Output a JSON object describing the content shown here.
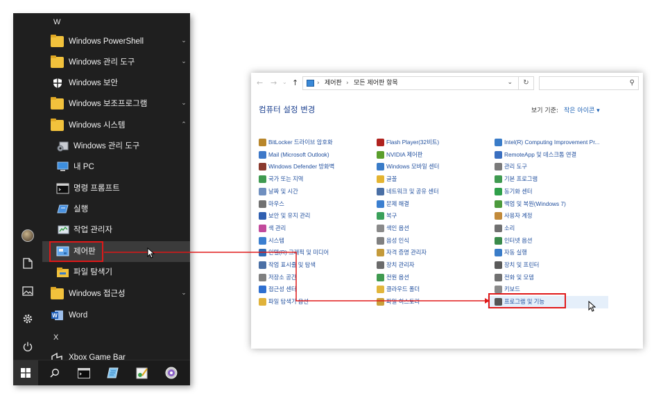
{
  "start_menu": {
    "letters": {
      "w": "W",
      "x": "X"
    },
    "apps": [
      {
        "name": "windows-powershell",
        "label": "Windows PowerShell",
        "icon": "folder-icon",
        "chevron": "down"
      },
      {
        "name": "windows-admin-tools",
        "label": "Windows 관리 도구",
        "icon": "folder-icon",
        "chevron": "down"
      },
      {
        "name": "windows-security",
        "label": "Windows 보안",
        "icon": "shield-icon"
      },
      {
        "name": "windows-accessories",
        "label": "Windows 보조프로그램",
        "icon": "folder-icon",
        "chevron": "down"
      },
      {
        "name": "windows-system",
        "label": "Windows 시스템",
        "icon": "folder-icon",
        "chevron": "up"
      },
      {
        "name": "admin-tools",
        "label": "Windows 관리 도구",
        "icon": "admin-tools-icon"
      },
      {
        "name": "my-pc",
        "label": "내 PC",
        "icon": "computer-icon"
      },
      {
        "name": "command-prompt",
        "label": "명령 프롬프트",
        "icon": "terminal-icon"
      },
      {
        "name": "run",
        "label": "실행",
        "icon": "run-icon"
      },
      {
        "name": "task-manager",
        "label": "작업 관리자",
        "icon": "task-manager-icon"
      },
      {
        "name": "control-panel",
        "label": "제어판",
        "icon": "control-panel-icon"
      },
      {
        "name": "file-explorer",
        "label": "파일 탐색기",
        "icon": "file-explorer-icon"
      },
      {
        "name": "windows-accessibility",
        "label": "Windows 접근성",
        "icon": "folder-icon",
        "chevron": "down"
      },
      {
        "name": "word",
        "label": "Word",
        "icon": "word-icon"
      },
      {
        "name": "xbox-game-bar",
        "label": "Xbox Game Bar",
        "icon": "xbox-icon"
      }
    ],
    "rail_icons": [
      "avatar-icon",
      "document-icon",
      "pictures-icon",
      "settings-icon",
      "power-icon"
    ],
    "taskbar_icons": [
      "windows-start-icon",
      "search-icon",
      "terminal-icon",
      "notepad-icon",
      "paint-icon",
      "media-player-icon"
    ]
  },
  "control_panel": {
    "address": {
      "root": "제어판",
      "current": "모든 제어판 항목",
      "separator": "›"
    },
    "title": "컴퓨터 설정 변경",
    "view_by_label": "보기 기준:",
    "view_mode": "작은 아이콘",
    "columns": [
      [
        {
          "label": "BitLocker 드라이브 암호화",
          "color": "#b8862b"
        },
        {
          "label": "Mail (Microsoft Outlook)",
          "color": "#3d78c8"
        },
        {
          "label": "Windows Defender 방화벽",
          "color": "#8a3a2e"
        },
        {
          "label": "국가 또는 지역",
          "color": "#3f9a50"
        },
        {
          "label": "날짜 및 시간",
          "color": "#6f8fbf"
        },
        {
          "label": "마우스",
          "color": "#707070"
        },
        {
          "label": "보안 및 유지 관리",
          "color": "#2f5fb0"
        },
        {
          "label": "색 관리",
          "color": "#c24a9c"
        },
        {
          "label": "시스템",
          "color": "#3b7fd0"
        },
        {
          "label": "인텔(R) 그래픽 및 미디어",
          "color": "#2f6bb5"
        },
        {
          "label": "작업 표시줄 및 탐색",
          "color": "#4a6fa5"
        },
        {
          "label": "저장소 공간",
          "color": "#808080"
        },
        {
          "label": "접근성 센터",
          "color": "#2e6fd0"
        },
        {
          "label": "파일 탐색기 옵션",
          "color": "#e0b23a"
        }
      ],
      [
        {
          "label": "Flash Player(32비트)",
          "color": "#b0231f"
        },
        {
          "label": "NVIDIA 제어판",
          "color": "#5a9e2c"
        },
        {
          "label": "Windows 모바일 센터",
          "color": "#3a7cc8"
        },
        {
          "label": "글꼴",
          "color": "#e4b431"
        },
        {
          "label": "네트워크 및 공유 센터",
          "color": "#4a6fa5"
        },
        {
          "label": "문제 해결",
          "color": "#3b7fd0"
        },
        {
          "label": "복구",
          "color": "#3aa05a"
        },
        {
          "label": "색인 옵션",
          "color": "#8a8a8a"
        },
        {
          "label": "음성 인식",
          "color": "#808080"
        },
        {
          "label": "자격 증명 관리자",
          "color": "#c49a3a"
        },
        {
          "label": "장치 관리자",
          "color": "#6b6b6b"
        },
        {
          "label": "전원 옵션",
          "color": "#3f9a50"
        },
        {
          "label": "클라우드 폴더",
          "color": "#e2b63c"
        },
        {
          "label": "파일 히스토리",
          "color": "#c9a13b"
        }
      ],
      [
        {
          "label": "Intel(R) Computing Improvement Pr...",
          "color": "#3a7cc8"
        },
        {
          "label": "RemoteApp 및 데스크톱 연결",
          "color": "#3a6fc0"
        },
        {
          "label": "관리 도구",
          "color": "#7a7a7a"
        },
        {
          "label": "기본 프로그램",
          "color": "#3f9a50"
        },
        {
          "label": "동기화 센터",
          "color": "#2fa04a"
        },
        {
          "label": "백업 및 복원(Windows 7)",
          "color": "#4c9a3c"
        },
        {
          "label": "사용자 계정",
          "color": "#c28a3a"
        },
        {
          "label": "소리",
          "color": "#707070"
        },
        {
          "label": "인터넷 옵션",
          "color": "#3a8a4a"
        },
        {
          "label": "자동 실행",
          "color": "#3a7cc8"
        },
        {
          "label": "장치 및 프린터",
          "color": "#5a5a5a"
        },
        {
          "label": "전화 및 모뎀",
          "color": "#707070"
        },
        {
          "label": "키보드",
          "color": "#8a8a8a"
        },
        {
          "label": "프로그램 및 기능",
          "color": "#555555"
        }
      ]
    ]
  }
}
